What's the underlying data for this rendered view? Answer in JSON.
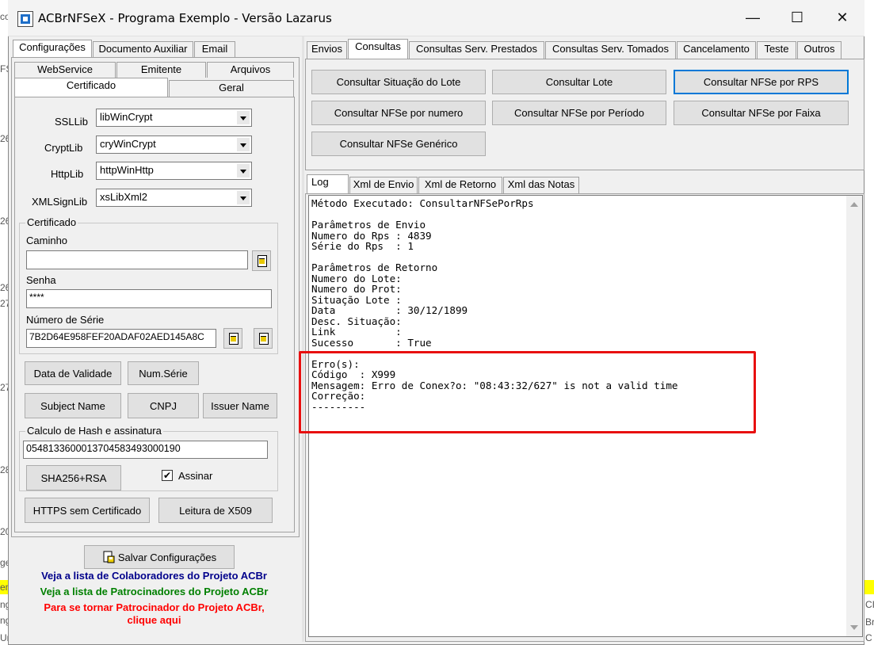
{
  "window": {
    "title": "ACBrNFSeX - Programa Exemplo - Versão Lazarus"
  },
  "left_tabs": [
    "Configurações",
    "Documento Auxiliar",
    "Email"
  ],
  "config_tabs_row1": [
    "WebService",
    "Emitente",
    "Arquivos"
  ],
  "config_tabs_row2": [
    "Certificado",
    "Geral"
  ],
  "ssl": {
    "ssllib_label": "SSLLib",
    "ssllib_value": "libWinCrypt",
    "cryptlib_label": "CryptLib",
    "cryptlib_value": "cryWinCrypt",
    "httplib_label": "HttpLib",
    "httplib_value": "httpWinHttp",
    "xmlsignlib_label": "XMLSignLib",
    "xmlsignlib_value": "xsLibXml2"
  },
  "certificado": {
    "group_title": "Certificado",
    "caminho_label": "Caminho",
    "caminho_value": "",
    "senha_label": "Senha",
    "senha_value": "****",
    "serie_label": "Número de Série",
    "serie_value": "7B2D64E958FEF20ADAF02AED145A8C"
  },
  "buttons_left": {
    "data_validade": "Data de Validade",
    "num_serie": "Num.Série",
    "subject_name": "Subject Name",
    "cnpj": "CNPJ",
    "issuer_name": "Issuer Name",
    "sha256": "SHA256+RSA",
    "https_sem_cert": "HTTPS sem Certificado",
    "leitura_x509": "Leitura de X509",
    "salvar": "Salvar Configurações"
  },
  "hash": {
    "group_title": "Calculo de Hash e assinatura",
    "value": "05481336000137045834930001​90",
    "assinar_label": "Assinar",
    "assinar_checked": true
  },
  "links": {
    "colaboradores": "Veja a lista de Colaboradores do Projeto ACBr",
    "patrocinadores": "Veja a lista de Patrocinadores do Projeto ACBr",
    "tornar_line1": "Para se tornar Patrocinador do Projeto ACBr,",
    "tornar_line2": "clique aqui",
    "colors": {
      "blue": "#00008b",
      "green": "#008000",
      "red": "#ff0000"
    }
  },
  "right_tabs": [
    "Envios",
    "Consultas",
    "Consultas Serv. Prestados",
    "Consultas Serv. Tomados",
    "Cancelamento",
    "Teste",
    "Outros"
  ],
  "consultas_buttons": [
    "Consultar Situação do Lote",
    "Consultar Lote",
    "Consultar NFSe por RPS",
    "Consultar NFSe por numero",
    "Consultar NFSe por Período",
    "Consultar NFSe por Faixa",
    "Consultar NFSe Genérico"
  ],
  "log_tabs": [
    "Log",
    "Xml de Envio",
    "Xml de Retorno",
    "Xml das Notas"
  ],
  "log_text": "Método Executado: ConsultarNFSePorRps\n\nParâmetros de Envio\nNumero do Rps : 4839\nSérie do Rps  : 1\n\nParâmetros de Retorno\nNumero do Lote:\nNumero do Prot:\nSituação Lote :\nData          : 30/12/1899\nDesc. Situação:\nLink          :\nSucesso       : True\n\nErro(s):\nCódigo  : X999\nMensagem: Erro de Conex?o: \"08:43:32/627\" is not a valid time\nCorreção:\n---------",
  "highlight_color": "#e81010",
  "background_edge": {
    "left_chars": [
      "co",
      "FS",
      "26",
      "26",
      "26",
      "27",
      "27",
      "28",
      "20",
      "ge",
      "en",
      "ng",
      "ng",
      "Ur"
    ],
    "right_chars": [
      "CI",
      "Br",
      "C"
    ]
  }
}
